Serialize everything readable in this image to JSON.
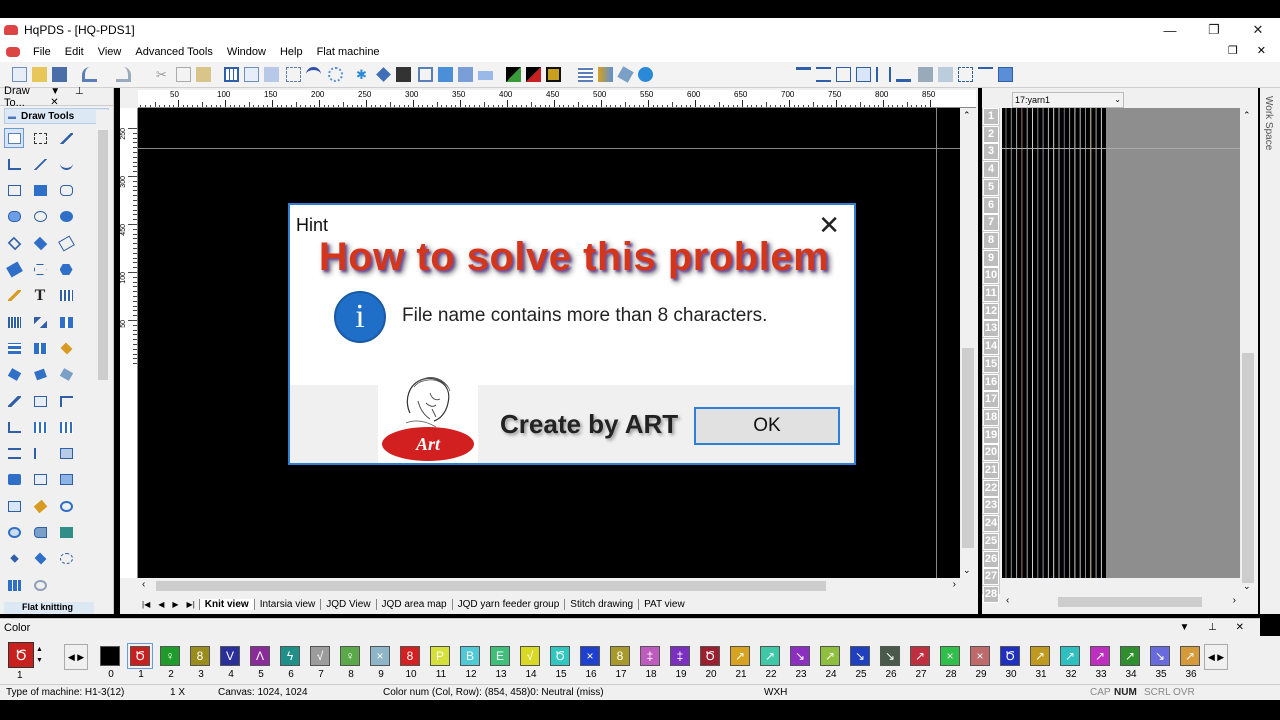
{
  "window": {
    "title": "HqPDS - [HQ-PDS1]",
    "minimize": "—",
    "restore": "❐",
    "close": "✕"
  },
  "menu": {
    "items": [
      "File",
      "Edit",
      "View",
      "Advanced Tools",
      "Window",
      "Help",
      "Flat machine"
    ],
    "mdi_controls": "❐ ✕"
  },
  "left_panel": {
    "title": "Draw To...",
    "header_icons": "▼ ⊥ ✕",
    "section": "Draw Tools",
    "footer": "Flat knitting"
  },
  "rulers": {
    "h_ticks": [
      "50",
      "100",
      "150",
      "200",
      "250",
      "300",
      "350",
      "400",
      "450",
      "500",
      "550",
      "600",
      "650",
      "700",
      "750",
      "800",
      "850"
    ],
    "v_ticks": [
      "250",
      "300",
      "450",
      "100",
      "50"
    ]
  },
  "view_tabs": {
    "nav": [
      "|◀",
      "◀",
      "▶",
      "▶|"
    ],
    "items": [
      "Knit view",
      "Intarsia view",
      "JQD View",
      "JQD area map",
      "JQD yarn feeder group",
      "Stitch drawing",
      "PAT view"
    ],
    "active": "Knit view"
  },
  "right_view": {
    "yarn_selector": "17:yarn1",
    "rows": [
      "1",
      "2",
      "3",
      "4",
      "5",
      "6",
      "7",
      "8",
      "9",
      "10",
      "11",
      "12",
      "13",
      "14",
      "15",
      "16",
      "17",
      "18",
      "19",
      "20",
      "21",
      "22",
      "23",
      "24",
      "25",
      "26",
      "27",
      "28"
    ]
  },
  "workspace_tab": "Work Space",
  "color_panel": {
    "title": "Color",
    "controls": "▼ ⊥ ✕",
    "current_label": "1",
    "swatches": [
      {
        "label": "0",
        "color": "#000000",
        "glyph": ""
      },
      {
        "label": "1",
        "color": "#c81f1f",
        "glyph": "Ծ"
      },
      {
        "label": "2",
        "color": "#1f9b2b",
        "glyph": "♀"
      },
      {
        "label": "3",
        "color": "#9a8c1c",
        "glyph": "8"
      },
      {
        "label": "4",
        "color": "#2b2f9a",
        "glyph": "V"
      },
      {
        "label": "5",
        "color": "#8a2b9a",
        "glyph": "Λ"
      },
      {
        "label": "6",
        "color": "#1f8f88",
        "glyph": "ϟ"
      },
      {
        "label": "7",
        "color": "#9c9c9c",
        "glyph": "√"
      },
      {
        "label": "8",
        "color": "#5aa84a",
        "glyph": "♀"
      },
      {
        "label": "9",
        "color": "#8fb5c8",
        "glyph": "×"
      },
      {
        "label": "10",
        "color": "#d42020",
        "glyph": "8"
      },
      {
        "label": "11",
        "color": "#d6e03a",
        "glyph": "P"
      },
      {
        "label": "12",
        "color": "#4fc9d6",
        "glyph": "B"
      },
      {
        "label": "13",
        "color": "#3fbf7a",
        "glyph": "E"
      },
      {
        "label": "14",
        "color": "#d8d825",
        "glyph": "√"
      },
      {
        "label": "15",
        "color": "#2fc7bf",
        "glyph": "Ծ"
      },
      {
        "label": "16",
        "color": "#1f3fcf",
        "glyph": "×"
      },
      {
        "label": "17",
        "color": "#a89a2a",
        "glyph": "8"
      },
      {
        "label": "18",
        "color": "#bf5abf",
        "glyph": "‡"
      },
      {
        "label": "19",
        "color": "#7a2fbf",
        "glyph": "‡"
      },
      {
        "label": "20",
        "color": "#9a1f2f",
        "glyph": "Ծ"
      },
      {
        "label": "21",
        "color": "#d6a21f",
        "glyph": "↗"
      },
      {
        "label": "22",
        "color": "#3fc7a8",
        "glyph": "↗"
      },
      {
        "label": "23",
        "color": "#8a2fbf",
        "glyph": "↘"
      },
      {
        "label": "24",
        "color": "#8fbf3f",
        "glyph": "↗"
      },
      {
        "label": "25",
        "color": "#1f3fbf",
        "glyph": "↘"
      },
      {
        "label": "26",
        "color": "#4a5a4a",
        "glyph": "↘"
      },
      {
        "label": "27",
        "color": "#bf2f3f",
        "glyph": "↗"
      },
      {
        "label": "28",
        "color": "#2fbf4a",
        "glyph": "×"
      },
      {
        "label": "29",
        "color": "#bf6a6a",
        "glyph": "×"
      },
      {
        "label": "30",
        "color": "#1f2fbf",
        "glyph": "Ծ"
      },
      {
        "label": "31",
        "color": "#bf9a1f",
        "glyph": "↗"
      },
      {
        "label": "32",
        "color": "#2fbfbf",
        "glyph": "↗"
      },
      {
        "label": "33",
        "color": "#bf2fbf",
        "glyph": "↗"
      },
      {
        "label": "34",
        "color": "#2f8f2f",
        "glyph": "↗"
      },
      {
        "label": "35",
        "color": "#6a6adf",
        "glyph": "↘"
      },
      {
        "label": "36",
        "color": "#d69a3a",
        "glyph": "↗"
      }
    ],
    "pager_left": "◀ ▶",
    "pager_right": "◀ ▶"
  },
  "status": {
    "machine": "Type of machine: H1-3(12)",
    "zoom": "1 X",
    "canvas": "Canvas: 1024, 1024",
    "color_num": "Color num  (Col, Row): (854, 458)0: Neutral (miss)",
    "wxh": "WXH",
    "cap": "CAP",
    "num": "NUM",
    "scrl": "SCRL",
    "ovr": "OVR"
  },
  "dialog": {
    "title": "Hint",
    "close": "✕",
    "overlay_text": "How to solve this problem",
    "icon": "i",
    "message": "File name contains more than 8 characters.",
    "logo_text": "Art",
    "credit": "Create by ART",
    "ok_label": "OK"
  },
  "colors": {
    "accent": "#2f7fd6",
    "canvas": "#000000",
    "dialog_bg": "#ffffff"
  }
}
